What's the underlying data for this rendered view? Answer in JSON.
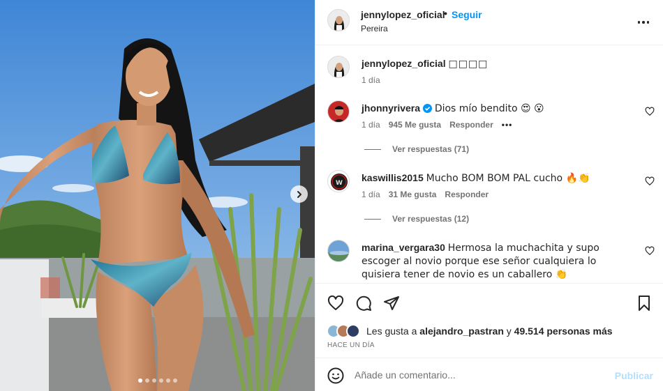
{
  "post": {
    "username": "jennylopez_oficial",
    "separator": "•",
    "follow_label": "Seguir",
    "location": "Pereira",
    "carousel_dots": 6,
    "carousel_active": 0
  },
  "caption": {
    "username": "jennylopez_oficial",
    "text": "",
    "time": "1 día"
  },
  "comments": [
    {
      "username": "jhonnyrivera",
      "verified": true,
      "text": "Dios mío bendito 😍 😮",
      "time": "1 día",
      "likes": "945 Me gusta",
      "reply": "Responder",
      "options": "•••",
      "replies": "Ver respuestas (71)"
    },
    {
      "username": "kaswillis2015",
      "verified": false,
      "text": "Mucho BOM BOM PAL cucho 🔥👏",
      "time": "1 día",
      "likes": "31 Me gusta",
      "reply": "Responder",
      "replies": "Ver respuestas (12)"
    },
    {
      "username": "marina_vergara30",
      "verified": false,
      "text": "Hermosa la muchachita y supo escoger al novio porque ese señor cualquiera lo quisiera tener de novio es un caballero 👏"
    }
  ],
  "likes": {
    "prefix": "Les gusta a",
    "user": "alejandro_pastran",
    "connector": "y",
    "others": "49.514 personas más"
  },
  "post_time": "HACE UN DÍA",
  "add_comment": {
    "placeholder": "Añade un comentario...",
    "publish_label": "Publicar"
  },
  "icons": {
    "like": "heart-icon",
    "comment": "comment-icon",
    "share": "share-icon",
    "save": "bookmark-icon",
    "more": "more-options-icon",
    "next": "chevron-right-icon",
    "emoji": "emoji-icon",
    "verified": "verified-badge-icon"
  },
  "colors": {
    "link_blue": "#0095f6",
    "publish_disabled": "#b2dffc",
    "verified": "#0095f6",
    "secondary_text": "#737373",
    "divider": "#efefef"
  }
}
